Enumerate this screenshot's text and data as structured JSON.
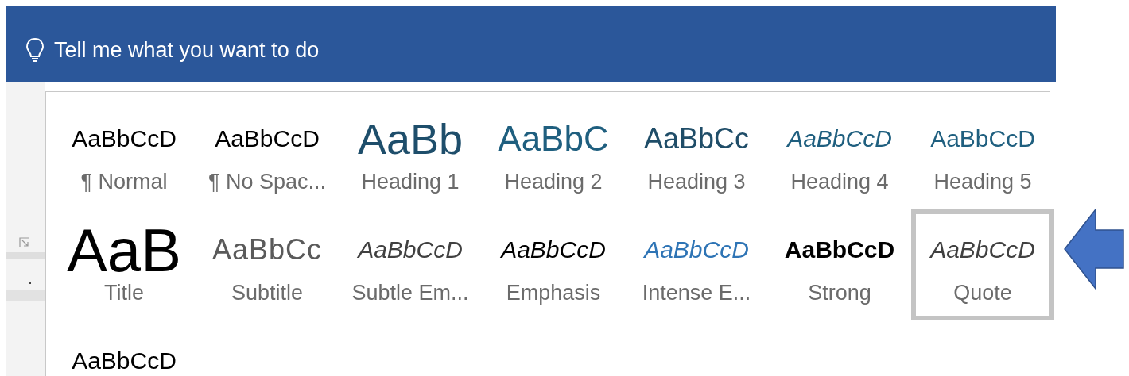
{
  "tell_me": {
    "placeholder": "Tell me what you want to do"
  },
  "styles": [
    {
      "kind": "normal",
      "preview": "AaBbCcD",
      "label": "¶ Normal",
      "selected": false
    },
    {
      "kind": "normal",
      "preview": "AaBbCcD",
      "label": "¶ No Spac...",
      "selected": false
    },
    {
      "kind": "heading1",
      "preview": "AaBb",
      "label": "Heading 1",
      "selected": false
    },
    {
      "kind": "heading2",
      "preview": "AaBbC",
      "label": "Heading 2",
      "selected": false
    },
    {
      "kind": "heading3",
      "preview": "AaBbCc",
      "label": "Heading 3",
      "selected": false
    },
    {
      "kind": "heading4",
      "preview": "AaBbCcD",
      "label": "Heading 4",
      "selected": false
    },
    {
      "kind": "heading5",
      "preview": "AaBbCcD",
      "label": "Heading 5",
      "selected": false
    },
    {
      "kind": "title",
      "preview": "AaB",
      "label": "Title",
      "selected": false
    },
    {
      "kind": "subtitle",
      "preview": "AaBbCc",
      "label": "Subtitle",
      "selected": false
    },
    {
      "kind": "subtle",
      "preview": "AaBbCcD",
      "label": "Subtle Em...",
      "selected": false
    },
    {
      "kind": "emphasis",
      "preview": "AaBbCcD",
      "label": "Emphasis",
      "selected": false
    },
    {
      "kind": "intense",
      "preview": "AaBbCcD",
      "label": "Intense E...",
      "selected": false
    },
    {
      "kind": "strong",
      "preview": "AaBbCcD",
      "label": "Strong",
      "selected": false
    },
    {
      "kind": "quote",
      "preview": "AaBbCcD",
      "label": "Quote",
      "selected": true
    },
    {
      "kind": "normal",
      "preview": "AaBbCcD",
      "selected": false
    }
  ]
}
